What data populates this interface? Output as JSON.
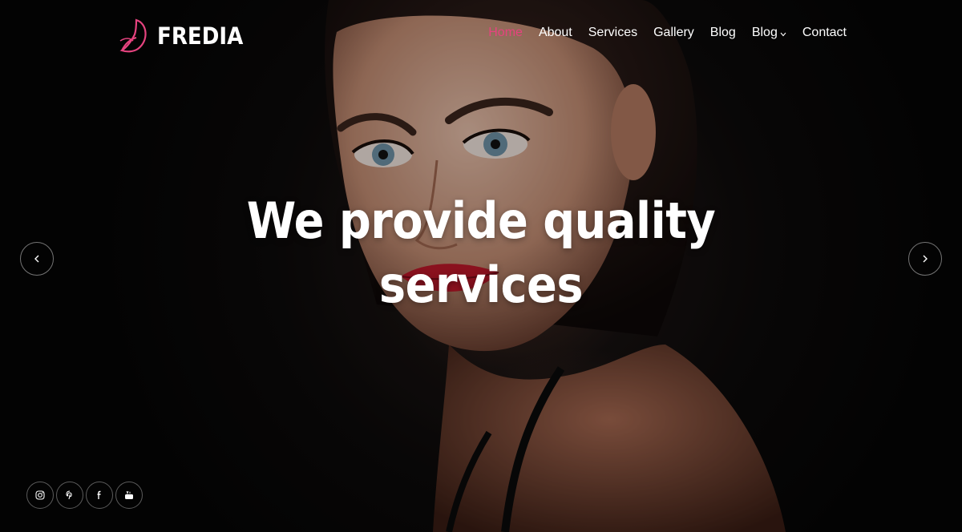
{
  "brand": {
    "name": "FREDIA",
    "accent_color": "#e6437f",
    "logo_icon": "butterfly-icon"
  },
  "nav": {
    "items": [
      {
        "label": "Home",
        "active": true
      },
      {
        "label": "About",
        "active": false
      },
      {
        "label": "Services",
        "active": false
      },
      {
        "label": "Gallery",
        "active": false
      },
      {
        "label": "Blog",
        "active": false
      },
      {
        "label": "Blog",
        "active": false,
        "dropdown": true
      },
      {
        "label": "Contact",
        "active": false
      }
    ]
  },
  "hero": {
    "headline_line1": "We provide quality",
    "headline_line2": "services",
    "prev_icon": "chevron-left-icon",
    "next_icon": "chevron-right-icon"
  },
  "social": {
    "icons": [
      "instagram-icon",
      "pinterest-icon",
      "facebook-icon",
      "youtube-icon"
    ]
  }
}
